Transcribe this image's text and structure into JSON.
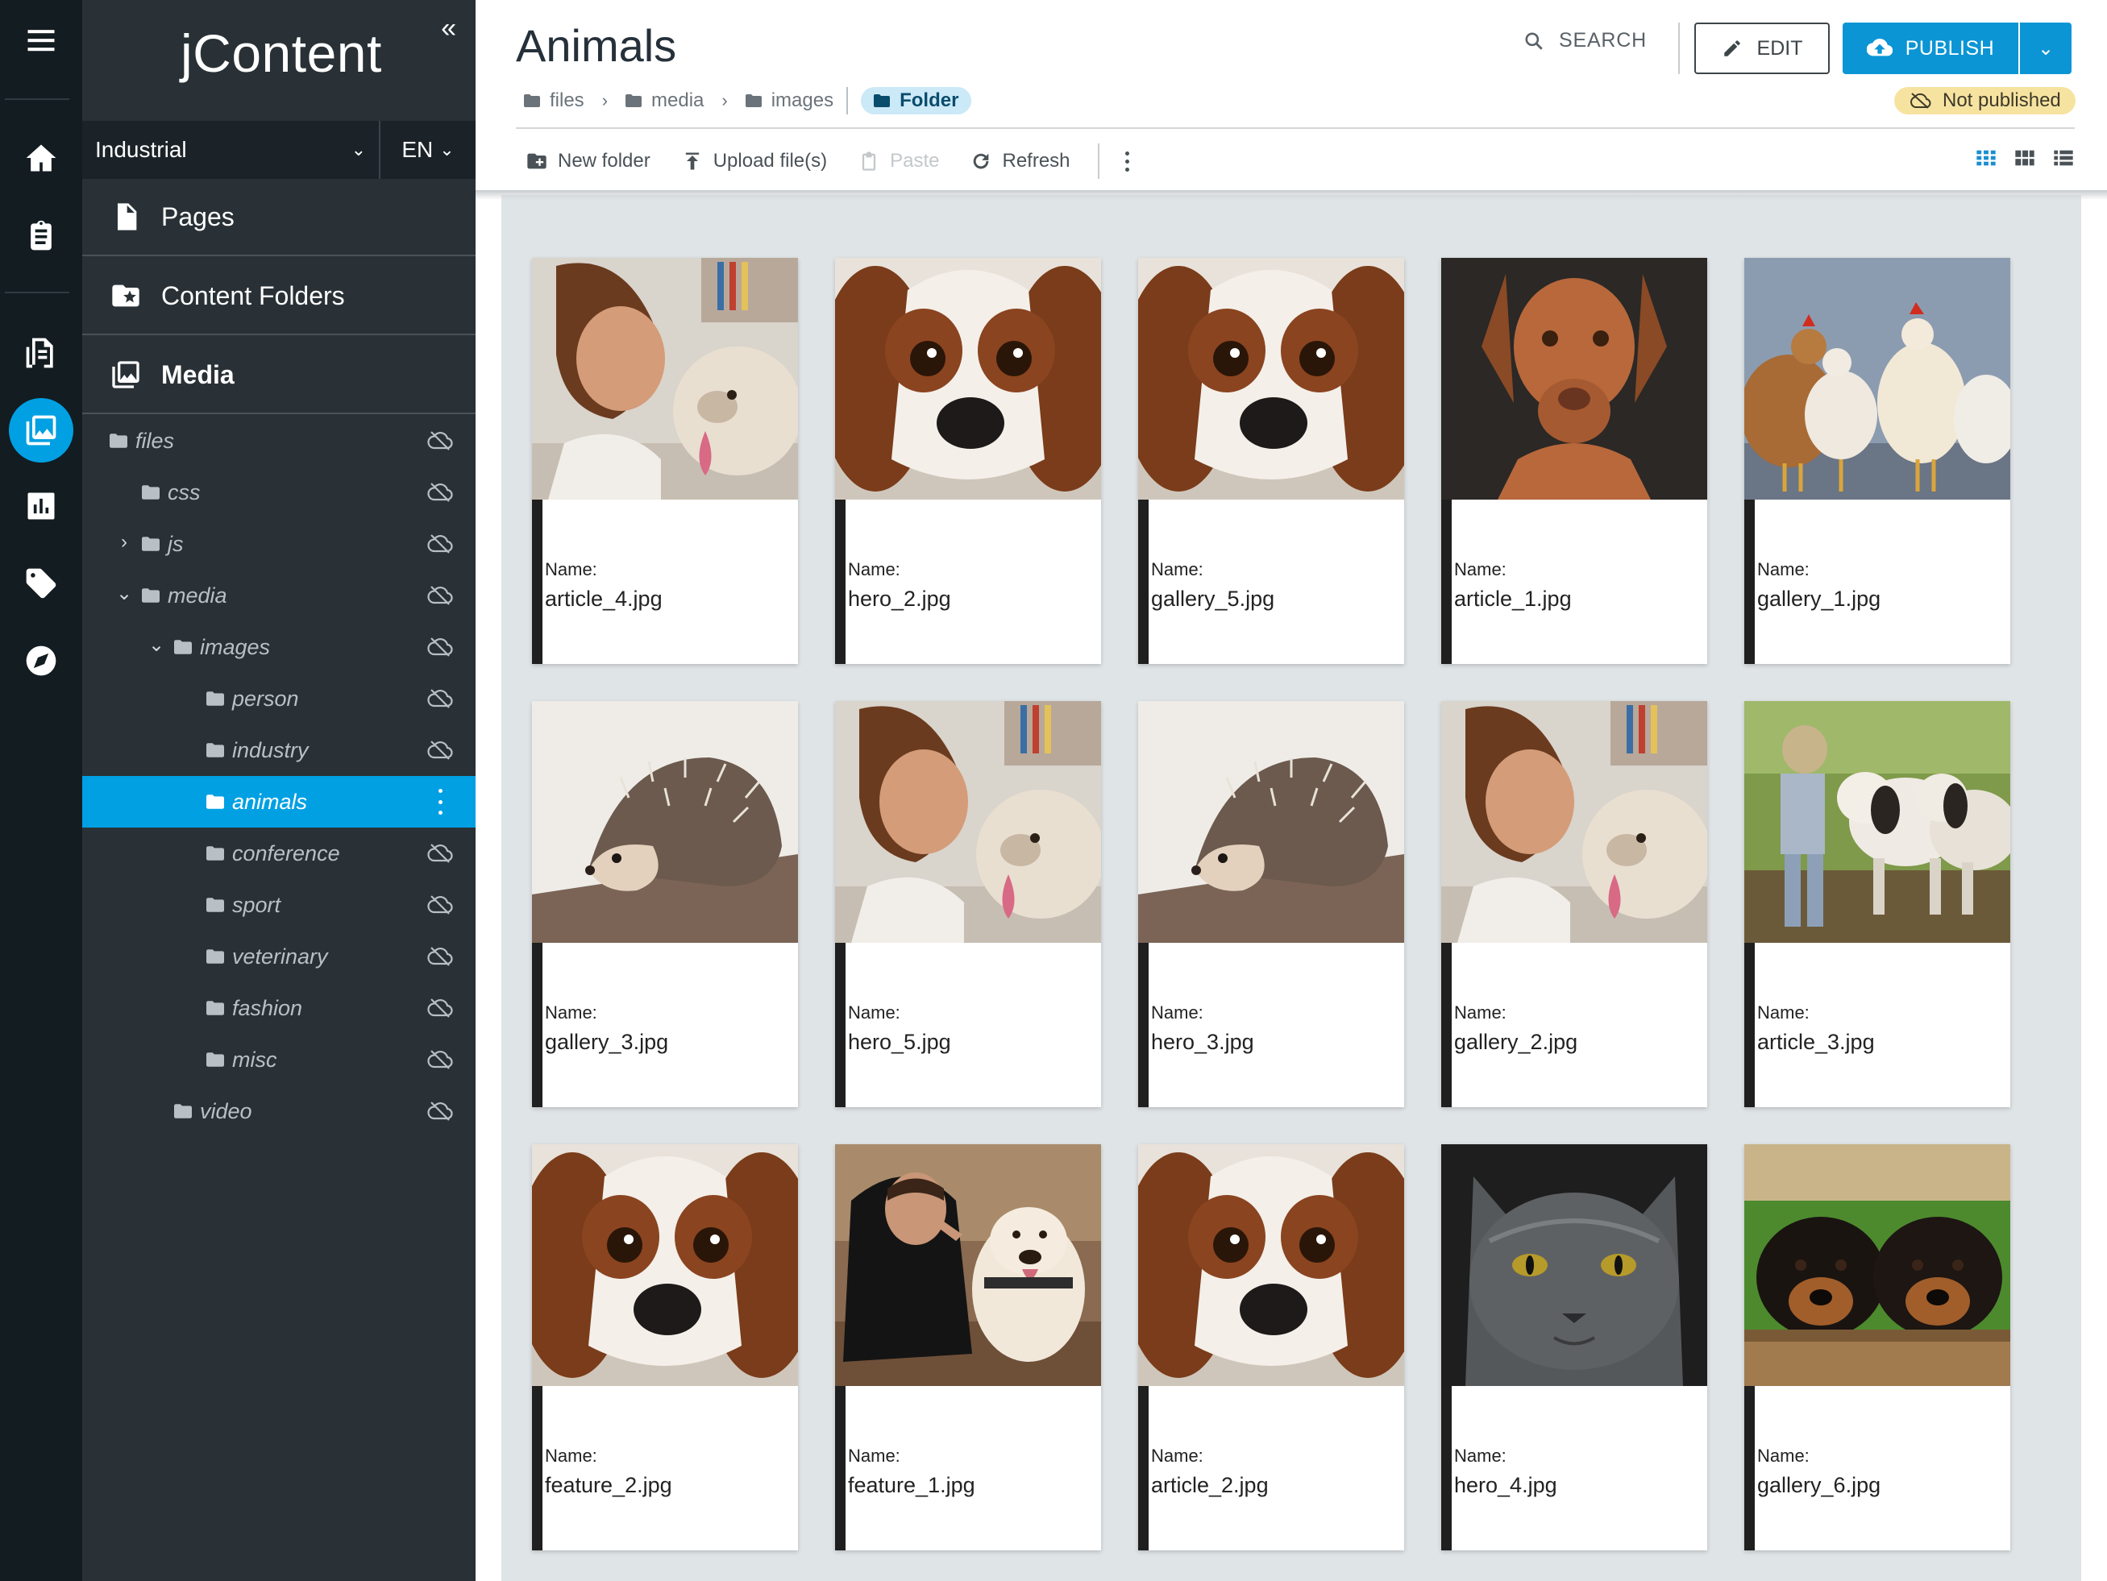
{
  "app": {
    "logo": "jContent",
    "site": "Industrial",
    "language": "EN"
  },
  "nav": {
    "sections": [
      {
        "label": "Pages",
        "icon": "page-icon"
      },
      {
        "label": "Content Folders",
        "icon": "content-folder-icon"
      },
      {
        "label": "Media",
        "icon": "media-icon"
      }
    ],
    "tree": [
      {
        "label": "files",
        "level": 0,
        "expand": "",
        "selected": false
      },
      {
        "label": "css",
        "level": 1,
        "expand": "",
        "selected": false
      },
      {
        "label": "js",
        "level": 1,
        "expand": "›",
        "selected": false
      },
      {
        "label": "media",
        "level": 1,
        "expand": "⌄",
        "selected": false
      },
      {
        "label": "images",
        "level": 2,
        "expand": "⌄",
        "selected": false
      },
      {
        "label": "person",
        "level": 3,
        "expand": "",
        "selected": false
      },
      {
        "label": "industry",
        "level": 3,
        "expand": "",
        "selected": false
      },
      {
        "label": "animals",
        "level": 3,
        "expand": "",
        "selected": true
      },
      {
        "label": "conference",
        "level": 3,
        "expand": "",
        "selected": false
      },
      {
        "label": "sport",
        "level": 3,
        "expand": "",
        "selected": false
      },
      {
        "label": "veterinary",
        "level": 3,
        "expand": "",
        "selected": false
      },
      {
        "label": "fashion",
        "level": 3,
        "expand": "",
        "selected": false
      },
      {
        "label": "misc",
        "level": 3,
        "expand": "",
        "selected": false
      },
      {
        "label": "video",
        "level": 2,
        "expand": "",
        "selected": false
      }
    ]
  },
  "header": {
    "title": "Animals",
    "breadcrumbs": [
      "files",
      "media",
      "images"
    ],
    "node_type": "Folder",
    "search_label": "SEARCH",
    "edit_label": "EDIT",
    "publish_label": "PUBLISH",
    "publication_status": "Not published"
  },
  "toolbar": {
    "new_folder": "New folder",
    "upload": "Upload file(s)",
    "paste": "Paste",
    "refresh": "Refresh"
  },
  "grid": {
    "name_label": "Name:",
    "files": [
      {
        "name": "article_4.jpg",
        "subject": "girl-dog"
      },
      {
        "name": "hero_2.jpg",
        "subject": "spaniel"
      },
      {
        "name": "gallery_5.jpg",
        "subject": "spaniel"
      },
      {
        "name": "article_1.jpg",
        "subject": "vizsla"
      },
      {
        "name": "gallery_1.jpg",
        "subject": "chickens"
      },
      {
        "name": "gallery_3.jpg",
        "subject": "hedgehog"
      },
      {
        "name": "hero_5.jpg",
        "subject": "girl-dog"
      },
      {
        "name": "hero_3.jpg",
        "subject": "hedgehog"
      },
      {
        "name": "gallery_2.jpg",
        "subject": "girl-dog"
      },
      {
        "name": "article_3.jpg",
        "subject": "cows"
      },
      {
        "name": "feature_2.jpg",
        "subject": "spaniel"
      },
      {
        "name": "feature_1.jpg",
        "subject": "man-dog"
      },
      {
        "name": "article_2.jpg",
        "subject": "spaniel"
      },
      {
        "name": "hero_4.jpg",
        "subject": "cat"
      },
      {
        "name": "gallery_6.jpg",
        "subject": "puppies"
      }
    ]
  },
  "colors": {
    "accent": "#00a0e3",
    "publish": "#0b95d4",
    "rail": "#131c21",
    "nav": "#293136",
    "status_badge": "#f7e3a0"
  }
}
